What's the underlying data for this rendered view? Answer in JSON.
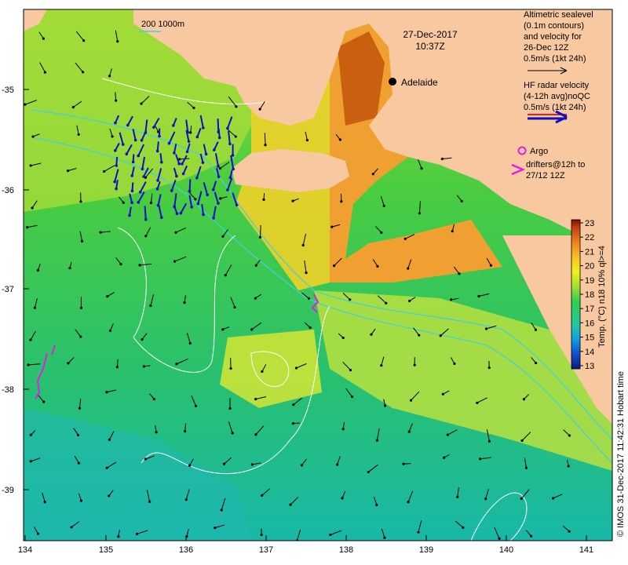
{
  "map": {
    "date": "27-Dec-2017",
    "time": "10:37Z",
    "city_label": "Adelaide",
    "scale_label": "200  1000m"
  },
  "legend": {
    "sealevel_lines": [
      "Altimetric sealevel",
      "(0.1m contours)",
      "and velocity for",
      "26-Dec 12Z",
      "0.5m/s (1kt 24h)"
    ],
    "radar_lines": [
      "HF radar velocity",
      "(4-12h avg)noQC",
      "0.5m/s (1kt 24h)"
    ],
    "argo_label": "Argo",
    "drifter_lines": [
      "drifters@12h to",
      "27/12 12Z"
    ]
  },
  "colorbar": {
    "ticks": [
      "23",
      "22",
      "21",
      "20",
      "19",
      "18",
      "17",
      "16",
      "15",
      "14",
      "13"
    ],
    "title": "Temp. (°C) n18 10% ql>=4"
  },
  "axes": {
    "x_ticks": [
      "134",
      "135",
      "136",
      "137",
      "138",
      "139",
      "140",
      "141"
    ],
    "y_ticks": [
      "-35",
      "-36",
      "-37",
      "-38",
      "-39"
    ]
  },
  "credit": "© IMOS 31-Dec-2017 11:42:31 Hobart time",
  "colors": {
    "land": "#f8c8a0",
    "deep_ocean": "#1ec878",
    "shelf": "#c8e040",
    "warm_gulf": "#f0a030",
    "radar_arrow": "#1010c0",
    "argo": "#e020e0",
    "contour": "#ffffff",
    "isobath": "#40d0e0"
  }
}
